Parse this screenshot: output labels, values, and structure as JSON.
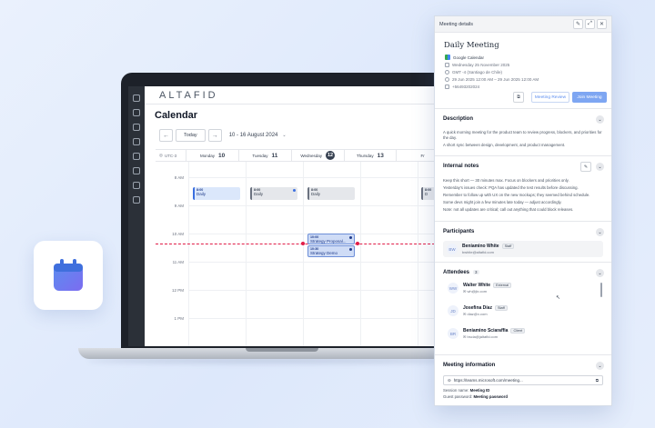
{
  "app": {
    "logo": "ALTAFID",
    "page_title": "Calendar"
  },
  "toolbar": {
    "prev": "←",
    "today": "Today",
    "next": "→",
    "range": "10 - 16 August 2024"
  },
  "grid": {
    "timezone": "UTC-3",
    "days": [
      {
        "name": "Monday",
        "num": "10"
      },
      {
        "name": "Tuesday",
        "num": "11"
      },
      {
        "name": "Wednesday",
        "num": "12"
      },
      {
        "name": "Thursday",
        "num": "13"
      },
      {
        "name": "Fr",
        "num": ""
      }
    ],
    "times": [
      "8 AM",
      "9 AM",
      "10 AM",
      "11 AM",
      "12 PM",
      "1 PM"
    ]
  },
  "events": [
    {
      "time": "8:00",
      "name": "Daily"
    },
    {
      "time": "8:00",
      "name": "Daily"
    },
    {
      "time": "8:00",
      "name": "Daily"
    },
    {
      "time": "8:00",
      "name": "D"
    },
    {
      "time": "10:00",
      "name": "Strategy Proposal..."
    },
    {
      "time": "10:30",
      "name": "Strategy Demo"
    }
  ],
  "panel": {
    "header": "Meeting details",
    "title": "Daily Meeting",
    "calendar": "Google Calendar",
    "date": "Wednesday 25 November 2025",
    "timezone": "GMT -4 (Santiago de Chile)",
    "schedule": "29 Jun 2025 12:00 AM – 29 Jun 2025 12:00 AM",
    "phone": "+56493202024",
    "btn_review": "Meeting Review",
    "btn_join": "Join Meeting",
    "description": {
      "title": "Description",
      "p1": "A quick morning meeting for the product team to review progress, blockers, and priorities for the day.",
      "p2": "A short sync between design, development, and product management."
    },
    "notes": {
      "title": "Internal notes",
      "lines": [
        "Keep this short — 30 minutes max. Focus on blockers and priorities only.",
        "Yesterday's issues check: PQA has updated the test results before discussing.",
        "Remember to follow up with UX on the new mockups; they seemed behind schedule.",
        "Some devs might join a few minutes late today — adjust accordingly.",
        "Note: not all updates are critical; call out anything that could block releases."
      ]
    },
    "participants": {
      "title": "Participants",
      "items": [
        {
          "initials": "BW",
          "name": "Beniamino White",
          "tag": "Staff",
          "email": "bwhite@altafid.com"
        }
      ]
    },
    "attendees": {
      "title": "Attendees",
      "count": "3",
      "items": [
        {
          "initials": "WW",
          "name": "Walter White",
          "tag": "External",
          "email": "wh@jlx.com"
        },
        {
          "initials": "JD",
          "name": "Josefina Díaz",
          "tag": "Staff",
          "email": "diaz@x.com"
        },
        {
          "initials": "BR",
          "name": "Beniamino Sciaraffia",
          "tag": "Client",
          "email": "bscia@jaltafid.com"
        }
      ]
    },
    "meeting_info": {
      "title": "Meeting information",
      "link": "https://teams.microsoft.com/meeting...",
      "session_label": "Session name:",
      "session_value": "Meeting ID",
      "password_label": "Guest password:",
      "password_value": "Meeting password"
    }
  },
  "colors": {
    "accent": "#5b8def",
    "now_line": "#e11d48",
    "sidebar": "#2b3038"
  }
}
